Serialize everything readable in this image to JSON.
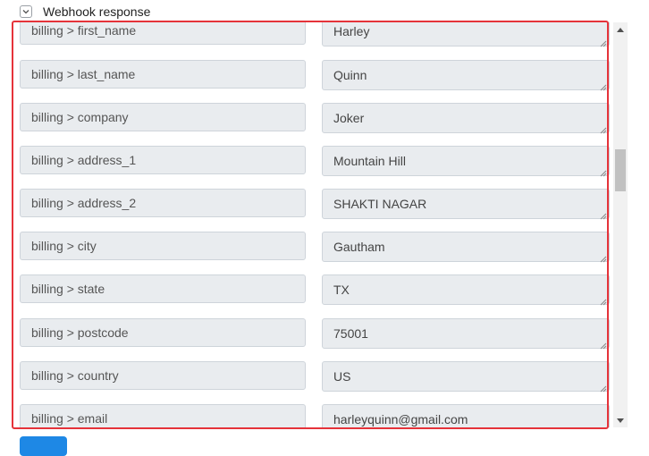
{
  "header": {
    "title": "Webhook response"
  },
  "rows": [
    {
      "key": "billing > first_name",
      "value": "Harley"
    },
    {
      "key": "billing > last_name",
      "value": "Quinn"
    },
    {
      "key": "billing > company",
      "value": "Joker"
    },
    {
      "key": "billing > address_1",
      "value": "Mountain Hill"
    },
    {
      "key": "billing > address_2",
      "value": "SHAKTI NAGAR"
    },
    {
      "key": "billing > city",
      "value": "Gautham"
    },
    {
      "key": "billing > state",
      "value": "TX"
    },
    {
      "key": "billing > postcode",
      "value": "75001"
    },
    {
      "key": "billing > country",
      "value": "US"
    },
    {
      "key": "billing > email",
      "value": "harleyquinn@gmail.com"
    }
  ],
  "footer": {
    "button_label": ""
  },
  "colors": {
    "highlight": "#e5333a",
    "primary": "#1e88e5",
    "field_bg": "#e9ecef"
  }
}
